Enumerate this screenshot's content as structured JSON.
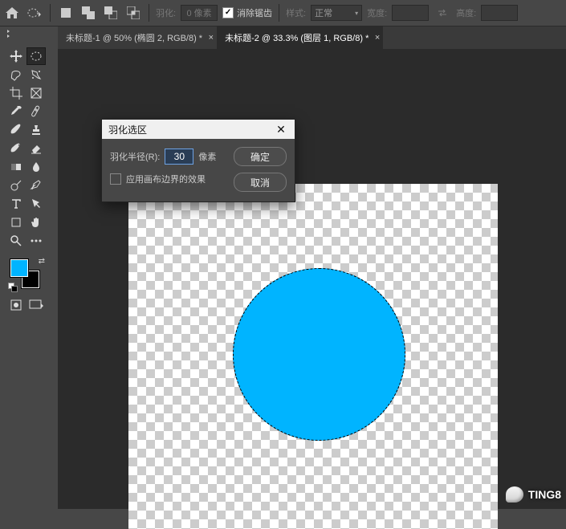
{
  "optbar": {
    "feather_label": "羽化:",
    "feather_value": "0 像素",
    "antialias_label": "消除锯齿",
    "style_label": "样式:",
    "style_value": "正常",
    "width_label": "宽度:",
    "height_label": "高度:"
  },
  "tabs": [
    {
      "label": "未标题-1 @ 50% (椭圆 2, RGB/8) *"
    },
    {
      "label": "未标题-2 @ 33.3% (图层 1, RGB/8) *"
    }
  ],
  "active_tab_index": 1,
  "colors": {
    "foreground": "#00b4ff",
    "background": "#000000",
    "circle_fill": "#00b4ff"
  },
  "dialog": {
    "title": "羽化选区",
    "radius_label": "羽化半径(R):",
    "radius_value": "30",
    "radius_unit": "像素",
    "apply_canvas_label": "应用画布边界的效果",
    "ok_label": "确定",
    "cancel_label": "取消"
  },
  "watermark": {
    "text": "TING8"
  }
}
